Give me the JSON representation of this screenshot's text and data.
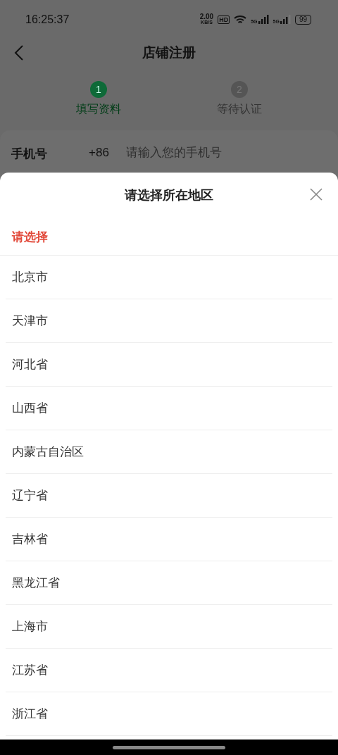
{
  "status_bar": {
    "time": "16:25:37",
    "net_speed": "2.00",
    "net_unit": "KB/S",
    "hd": "HD",
    "signals": [
      "5G",
      "5G"
    ],
    "battery": "99"
  },
  "header": {
    "title": "店铺注册"
  },
  "steps": [
    {
      "number": "1",
      "label": "填写资料",
      "selected": true
    },
    {
      "number": "2",
      "label": "等待认证",
      "selected": false
    }
  ],
  "form": {
    "label": "手机号",
    "prefix": "+86",
    "placeholder": "请输入您的手机号"
  },
  "sheet": {
    "title": "请选择所在地区",
    "tabs": [
      {
        "label": "请选择",
        "selected": true
      }
    ],
    "options": [
      "北京市",
      "天津市",
      "河北省",
      "山西省",
      "内蒙古自治区",
      "辽宁省",
      "吉林省",
      "黑龙江省",
      "上海市",
      "江苏省",
      "浙江省"
    ]
  }
}
